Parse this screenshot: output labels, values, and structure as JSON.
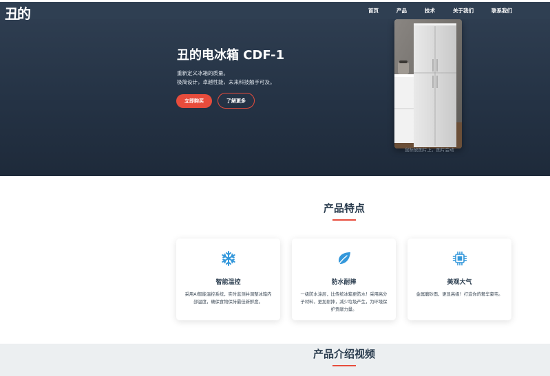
{
  "nav": {
    "logo": "丑的",
    "links": [
      "首页",
      "产品",
      "技术",
      "关于我们",
      "联系我们"
    ]
  },
  "hero": {
    "title": "丑的电冰箱 CDF-1",
    "desc_line1": "重新定义冰箱的质量。",
    "desc_line2": "极简设计，卓越性能，未来科技触手可及。",
    "buy_label": "立即购买",
    "more_label": "了解更多",
    "image_caption": "鼠标放图片上，图片会动"
  },
  "features": {
    "title": "产品特点",
    "cards": [
      {
        "icon": "snowflake-icon",
        "title": "智能温控",
        "text": "采用AI智能温控系统，实时监测并调整冰箱内部温度，确保食物保持最佳新鲜度。"
      },
      {
        "icon": "leaf-icon",
        "title": "防水耐摔",
        "text": "一级防水涂层，比传统冰箱更防水！采用高分子材料，更加耐摔，减少垃圾产生，为环境保护贡献力量。"
      },
      {
        "icon": "chip-icon",
        "title": "美观大气",
        "text": "金属磨砂面，更显高级！打造你的奢华豪宅。"
      }
    ]
  },
  "video": {
    "title": "产品介绍视频"
  },
  "colors": {
    "accent": "#e74c3c",
    "icon_blue": "#3498db",
    "nav_bg": "#2f3f52"
  }
}
